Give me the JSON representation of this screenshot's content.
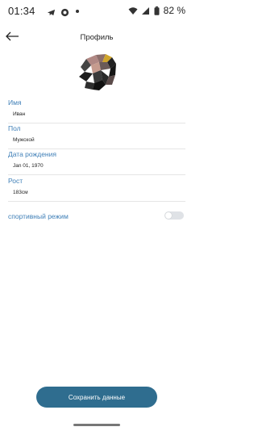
{
  "status_bar": {
    "time": "01:34",
    "battery": "82 %",
    "icons": [
      "telegram-icon",
      "app-icon",
      "wifi-icon",
      "signal-icon",
      "battery-icon"
    ]
  },
  "header": {
    "title": "Профиль",
    "back_icon": "arrow-left-icon"
  },
  "profile": {
    "fields": [
      {
        "label": "Имя",
        "value": "Иван"
      },
      {
        "label": "Пол",
        "value": "Мужской"
      },
      {
        "label": "Дата рождения",
        "value": "Jan 01, 1970"
      },
      {
        "label": "Рост",
        "value": "183см"
      }
    ],
    "sport_mode_label": "спортивный режим",
    "sport_mode_enabled": false
  },
  "actions": {
    "save_label": "Сохранить данные"
  },
  "colors": {
    "accent": "#3f7fb7",
    "button": "#2f6d8f",
    "background": "#ffffff"
  }
}
